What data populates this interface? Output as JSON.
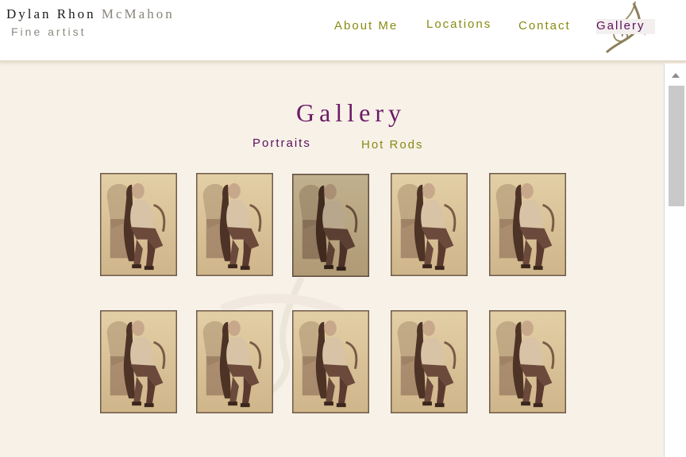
{
  "header": {
    "name_first": "Dylan Rhon",
    "name_last": "McMahon",
    "tagline": "Fine artist",
    "nav": [
      {
        "label": "About Me",
        "active": false
      },
      {
        "label": "Locations",
        "active": false
      },
      {
        "label": "Contact",
        "active": false
      },
      {
        "label": "Gallery",
        "active": true
      }
    ]
  },
  "main": {
    "title": "Gallery",
    "subnav": [
      {
        "label": "Portraits",
        "active": true
      },
      {
        "label": "Hot Rods",
        "active": false
      }
    ],
    "gallery_rows": 2,
    "gallery_columns": 5
  },
  "colors": {
    "page_bg": "#f7f1e8",
    "accent_purple": "#6b1a66",
    "accent_olive": "#8a8a12",
    "sepia": "#d9c39a"
  },
  "icons": [
    "swirl-ornament-icon",
    "scroll-up-arrow-icon"
  ]
}
